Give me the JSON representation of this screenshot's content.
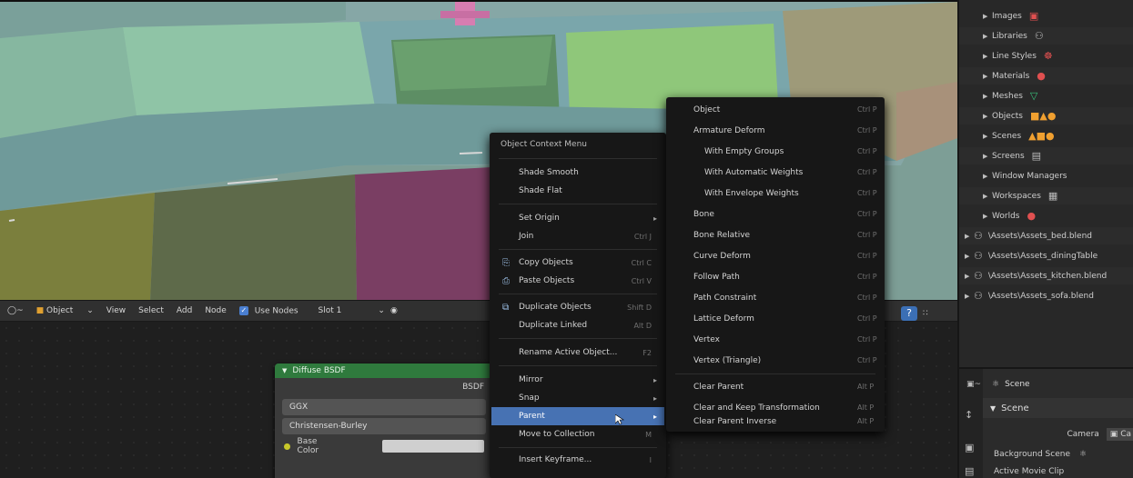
{
  "node_header": {
    "editor_type": "◯~",
    "object_menu": "Object",
    "view": "View",
    "select": "Select",
    "add": "Add",
    "node": "Node",
    "use_nodes": "Use Nodes",
    "slot": "Slot 1"
  },
  "outliner": {
    "items": [
      {
        "label": "Images",
        "icon": "▣"
      },
      {
        "label": "Libraries",
        "icon": "⚇"
      },
      {
        "label": "Line Styles",
        "icon": "☸"
      },
      {
        "label": "Materials",
        "icon": "●"
      },
      {
        "label": "Meshes",
        "icon": "▽"
      },
      {
        "label": "Objects",
        "icon": "■▲●"
      },
      {
        "label": "Scenes",
        "icon": "▲■●"
      },
      {
        "label": "Screens",
        "icon": "▤"
      },
      {
        "label": "Window Managers",
        "icon": ""
      },
      {
        "label": "Workspaces",
        "icon": "▦"
      },
      {
        "label": "Worlds",
        "icon": "●"
      },
      {
        "label": "\\Assets\\Assets_bed.blend",
        "icon": "⚇"
      },
      {
        "label": "\\Assets\\Assets_diningTable",
        "icon": "⚇"
      },
      {
        "label": "\\Assets\\Assets_kitchen.blend",
        "icon": "⚇"
      },
      {
        "label": "\\Assets\\Assets_sofa.blend",
        "icon": "⚇"
      }
    ]
  },
  "node": {
    "title": "Diffuse BSDF",
    "output": "BSDF",
    "distribution": "GGX",
    "subsurface": "Christensen-Burley",
    "base_color": "Base Color"
  },
  "properties": {
    "scene_name": "Scene",
    "section": "Scene",
    "camera_label": "Camera",
    "camera_value": "Ca",
    "background_scene": "Background Scene",
    "active_movie_clip": "Active Movie Clip"
  },
  "context_menu": {
    "title": "Object Context Menu",
    "items": [
      {
        "label": "Shade Smooth",
        "shortcut": "",
        "icon": "",
        "arrow": false
      },
      {
        "label": "Shade Flat",
        "shortcut": "",
        "icon": "",
        "arrow": false
      },
      {
        "label": "Set Origin",
        "shortcut": "",
        "icon": "",
        "arrow": true
      },
      {
        "label": "Join",
        "shortcut": "Ctrl J",
        "icon": "",
        "arrow": false
      },
      {
        "label": "Copy Objects",
        "shortcut": "Ctrl C",
        "icon": "⎘",
        "arrow": false
      },
      {
        "label": "Paste Objects",
        "shortcut": "Ctrl V",
        "icon": "⎙",
        "arrow": false
      },
      {
        "label": "Duplicate Objects",
        "shortcut": "Shift D",
        "icon": "⧉",
        "arrow": false
      },
      {
        "label": "Duplicate Linked",
        "shortcut": "Alt D",
        "icon": "",
        "arrow": false
      },
      {
        "label": "Rename Active Object...",
        "shortcut": "F2",
        "icon": "",
        "arrow": false
      },
      {
        "label": "Mirror",
        "shortcut": "",
        "icon": "",
        "arrow": true
      },
      {
        "label": "Snap",
        "shortcut": "",
        "icon": "",
        "arrow": true
      },
      {
        "label": "Parent",
        "shortcut": "",
        "icon": "",
        "arrow": true
      },
      {
        "label": "Move to Collection",
        "shortcut": "M",
        "icon": "",
        "arrow": false
      },
      {
        "label": "Insert Keyframe...",
        "shortcut": "I",
        "icon": "",
        "arrow": false
      }
    ]
  },
  "parent_menu": {
    "items": [
      {
        "label": "Object",
        "shortcut": "Ctrl P"
      },
      {
        "label": "Armature Deform",
        "shortcut": "Ctrl P"
      },
      {
        "label": "With Empty Groups",
        "shortcut": "Ctrl P"
      },
      {
        "label": "With Automatic Weights",
        "shortcut": "Ctrl P"
      },
      {
        "label": "With Envelope Weights",
        "shortcut": "Ctrl P"
      },
      {
        "label": "Bone",
        "shortcut": "Ctrl P"
      },
      {
        "label": "Bone Relative",
        "shortcut": "Ctrl P"
      },
      {
        "label": "Curve Deform",
        "shortcut": "Ctrl P"
      },
      {
        "label": "Follow Path",
        "shortcut": "Ctrl P"
      },
      {
        "label": "Path Constraint",
        "shortcut": "Ctrl P"
      },
      {
        "label": "Lattice Deform",
        "shortcut": "Ctrl P"
      },
      {
        "label": "Vertex",
        "shortcut": "Ctrl P"
      },
      {
        "label": "Vertex (Triangle)",
        "shortcut": "Ctrl P"
      },
      {
        "label": "Clear Parent",
        "shortcut": "Alt P"
      },
      {
        "label": "Clear and Keep Transformation",
        "shortcut": "Alt P"
      },
      {
        "label": "Clear Parent Inverse",
        "shortcut": "Alt P"
      }
    ]
  },
  "colors": {
    "accent": "#4772b3",
    "node_header": "#2f7a3d",
    "menu_bg": "#171717"
  }
}
